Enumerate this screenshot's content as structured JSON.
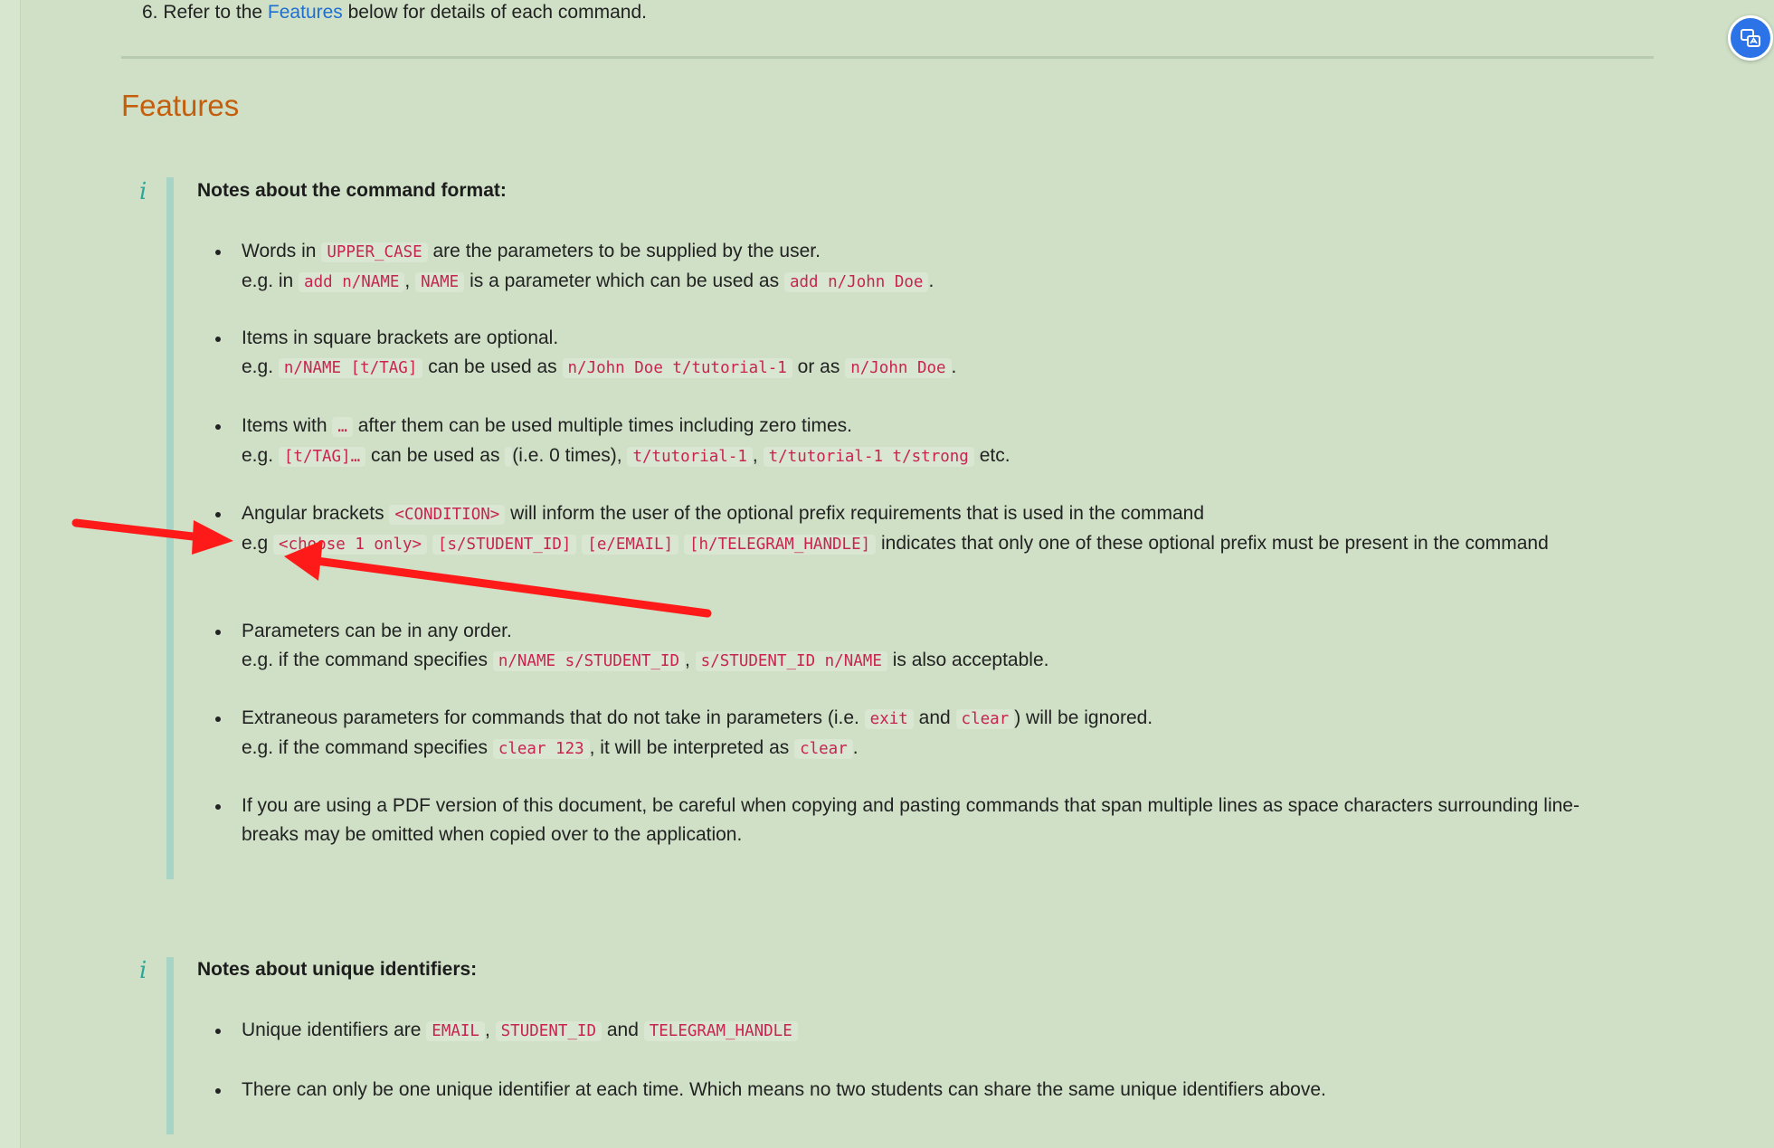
{
  "intro": {
    "prefix": "6. Refer to the ",
    "link": "Features",
    "suffix": " below for details of each command."
  },
  "features_title": "Features",
  "command_format": {
    "title": "Notes about the command format:",
    "items": [
      {
        "l1_a": "Words in ",
        "l1_c1": "UPPER_CASE",
        "l1_b": " are the parameters to be supplied by the user.",
        "l2_a": "e.g. in ",
        "l2_c1": "add n/NAME",
        "l2_b": ", ",
        "l2_c2": "NAME",
        "l2_c": " is a parameter which can be used as ",
        "l2_c3": "add n/John Doe",
        "l2_d": "."
      },
      {
        "l1_a": "Items in square brackets are optional.",
        "l2_a": "e.g. ",
        "l2_c1": "n/NAME [t/TAG]",
        "l2_b": " can be used as ",
        "l2_c2": "n/John Doe t/tutorial-1",
        "l2_c": " or as ",
        "l2_c3": "n/John Doe",
        "l2_d": "."
      },
      {
        "l1_a": "Items with ",
        "l1_c1": "…",
        "l1_b": " after them can be used multiple times including zero times.",
        "l2_a": "e.g. ",
        "l2_c1": "[t/TAG]…",
        "l2_b": " can be used as ",
        "l2_c2": "",
        "l2_c": " (i.e. 0 times), ",
        "l2_c3": "t/tutorial-1",
        "l2_d": ", ",
        "l2_c4": "t/tutorial-1 t/strong",
        "l2_e": " etc."
      },
      {
        "l1_a": "Angular brackets ",
        "l1_c1": "<CONDITION>",
        "l1_b": " will inform the user of the optional prefix requirements that is used in the command",
        "l2_a": "e.g ",
        "l2_c1": "<choose 1 only>",
        "l2_c2": "[s/STUDENT_ID]",
        "l2_c3": "[e/EMAIL]",
        "l2_c4": "[h/TELEGRAM_HANDLE]",
        "l2_b": " indicates that only one of these optional prefix must be present in the command"
      },
      {
        "l1_a": "Parameters can be in any order.",
        "l2_a": "e.g. if the command specifies ",
        "l2_c1": "n/NAME s/STUDENT_ID",
        "l2_b": ", ",
        "l2_c2": "s/STUDENT_ID n/NAME",
        "l2_c": " is also acceptable."
      },
      {
        "l1_a": "Extraneous parameters for commands that do not take in parameters (i.e. ",
        "l1_c1": "exit",
        "l1_b": " and ",
        "l1_c2": "clear",
        "l1_c": ") will be ignored.",
        "l2_a": "e.g. if the command specifies ",
        "l2_c1": "clear 123",
        "l2_b": ", it will be interpreted as ",
        "l2_c2": "clear",
        "l2_c": "."
      },
      {
        "l1_a": "If you are using a PDF version of this document, be careful when copying and pasting commands that span multiple lines as space characters surrounding line-breaks may be omitted when copied over to the application."
      }
    ]
  },
  "unique_ids": {
    "title": "Notes about unique identifiers:",
    "items": [
      {
        "a": "Unique identifiers are ",
        "c1": "EMAIL",
        "b": ", ",
        "c2": "STUDENT_ID",
        "c": " and ",
        "c3": "TELEGRAM_HANDLE"
      },
      {
        "a": "There can only be one unique identifier at each time. Which means no two students can share the same unique identifiers above."
      }
    ]
  },
  "icons": {
    "info": "i",
    "fab": "translate-icon"
  },
  "colors": {
    "background": "#cfe0c6",
    "heading": "#c45e0c",
    "link": "#1f6fd1",
    "code": "#c7254e",
    "callout_bar": "#a8d4c6",
    "info_icon": "#2ba89a",
    "annotation_arrow": "#ff1a1a",
    "fab": "#2b73e6"
  }
}
